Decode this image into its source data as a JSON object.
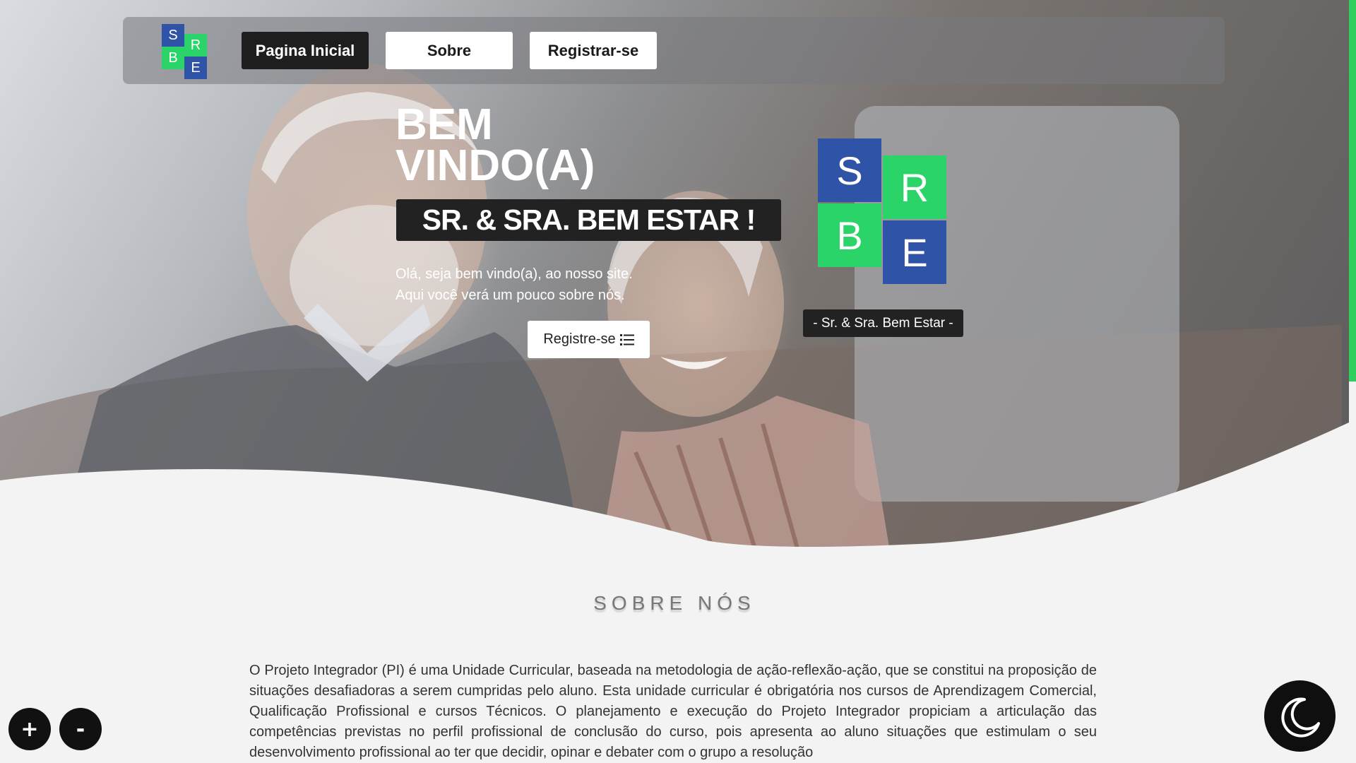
{
  "nav": {
    "logo_letters": [
      "S",
      "R",
      "B",
      "E"
    ],
    "items": [
      {
        "label": "Pagina Inicial",
        "active": true
      },
      {
        "label": "Sobre",
        "active": false
      },
      {
        "label": "Registrar-se",
        "active": false
      }
    ]
  },
  "hero": {
    "welcome_line1": "BEM",
    "welcome_line2": "VINDO(A)",
    "tagline": "SR. & SRA. BEM ESTAR !",
    "intro_line1": "Olá, seja bem vindo(a), ao nosso site.",
    "intro_line2": "Aqui você verá um pouco sobre nós.",
    "cta_label": "Registre-se",
    "cta_icon": "list-icon",
    "logo_letters": [
      "S",
      "R",
      "B",
      "E"
    ],
    "logo_caption": "- Sr. & Sra. Bem Estar -"
  },
  "about": {
    "title": "SOBRE NÓS",
    "text": "O Projeto Integrador (PI) é uma Unidade Curricular, baseada na metodologia de ação-reflexão-ação, que se constitui na proposição de situações desafiadoras a serem cumpridas pelo aluno. Esta unidade curricular é obrigatória nos cursos de Aprendizagem Comercial, Qualificação Profissional e cursos Técnicos. O planejamento e execução do Projeto Integrador propiciam a articulação das competências previstas no perfil profissional de conclusão do curso, pois apresenta ao aluno situações que estimulam o seu desenvolvimento profissional ao ter que decidir, opinar e debater com o grupo a resolução"
  },
  "controls": {
    "zoom_in": "+",
    "zoom_out": "-",
    "theme_icon": "moon-icon"
  },
  "colors": {
    "logo_blue": "#2f53a6",
    "logo_green": "#2bd468",
    "dark": "#1e1e1e",
    "scroll_accent": "#2fcf5d"
  }
}
